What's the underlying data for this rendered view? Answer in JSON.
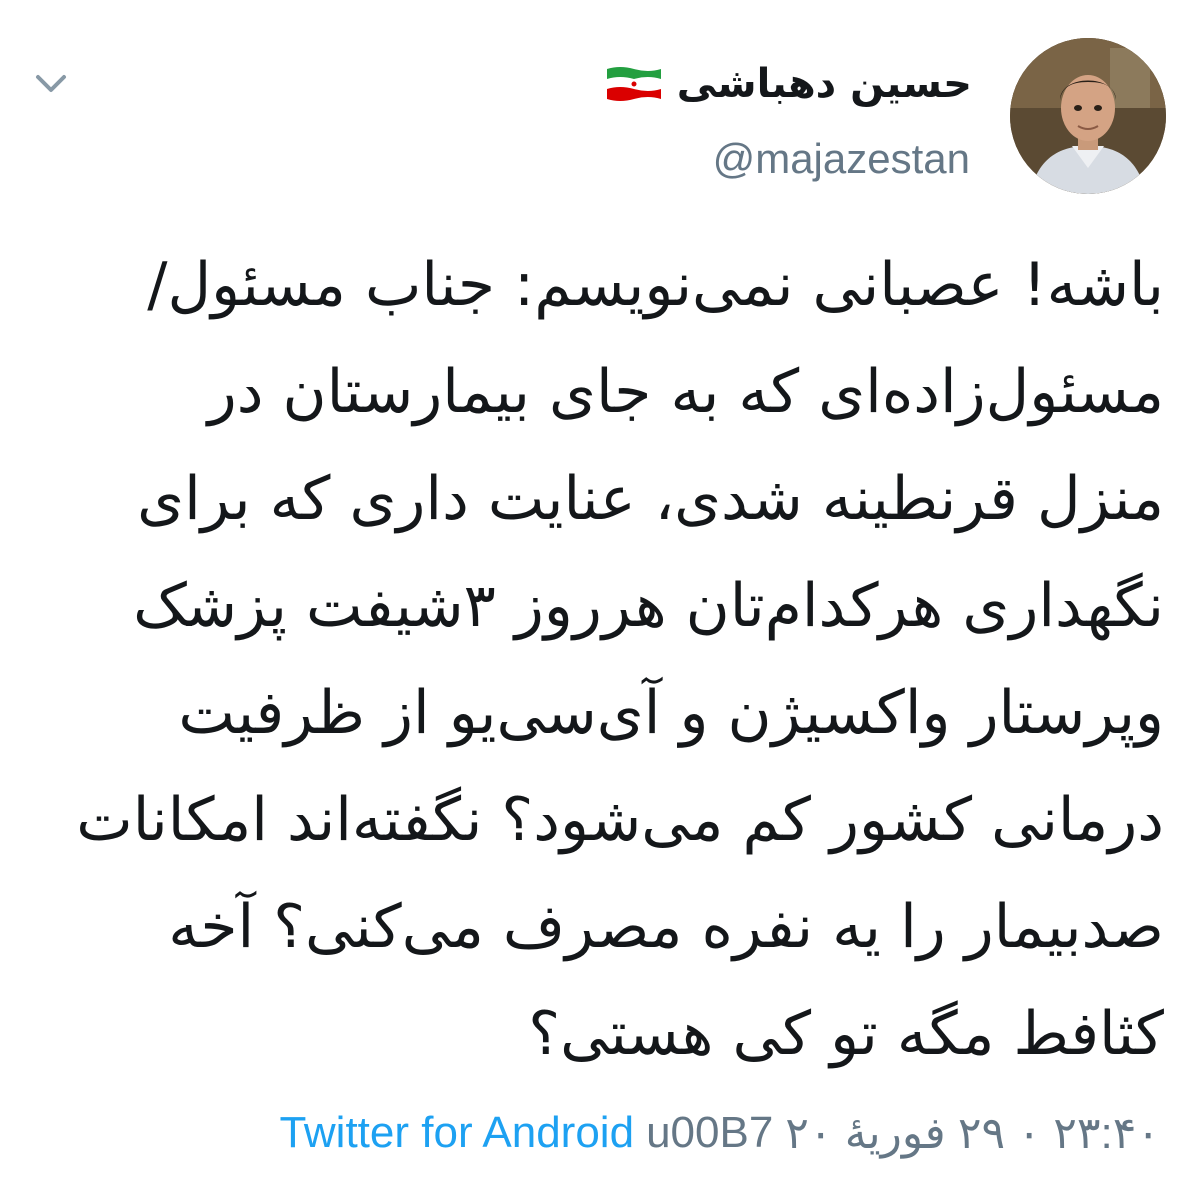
{
  "author": {
    "name": "حسین دهباشی",
    "handle": "@majazestan"
  },
  "icons": {
    "menu": "chevron-down-icon",
    "flag": "iran-flag-icon",
    "avatar": "profile-photo"
  },
  "tweet": {
    "lines": [
      "باشه! عصبانی نمی‌نویسم: جناب مسئول/",
      "مسئول‌زاده‌ای که به جای بیمارستان در",
      "منزل قرنطینه شدی، عنایت داری که برای",
      "نگهداری هرکدام‌تان هرروز ۳شیفت پزشک",
      "وپرستار واکسیژن و آی‌سی‌یو از ظرفیت",
      "درمانی کشور کم می‌شود؟ نگفته‌اند امکانات",
      "صدبیمار را یه نفره مصرف می‌کنی؟ آخه",
      "کثافط مگه تو کی هستی؟"
    ]
  },
  "meta": {
    "source": "Twitter for Android",
    "separator": "u00B7",
    "date": "۲۳:۴۰ ۰ ۲۹ فوریهٔ ۲۰"
  },
  "colors": {
    "link": "#1da1f2",
    "secondary": "#657786",
    "text": "#14171a"
  }
}
